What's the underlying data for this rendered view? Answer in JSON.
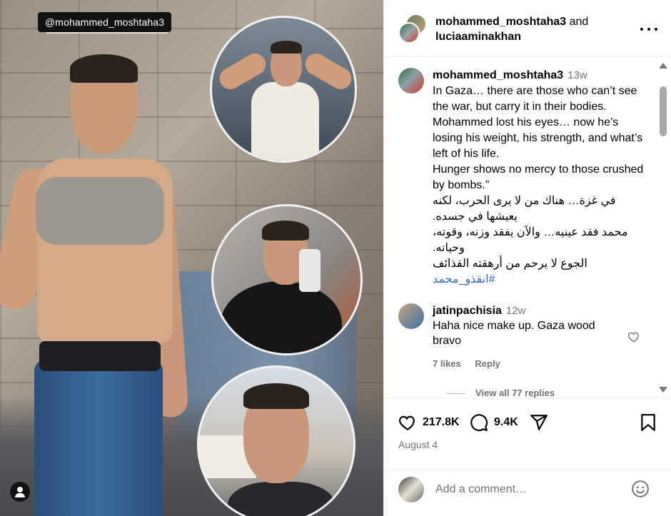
{
  "media": {
    "watermark": "@mohammed_moshtaha3"
  },
  "header": {
    "user1": "mohammed_moshtaha3",
    "conjunction": "and",
    "user2": "luciaaminakhan"
  },
  "caption": {
    "username": "mohammed_moshtaha3",
    "age": "13w",
    "text": "In Gaza… there are those who can’t see the war, but carry it in their bodies.\nMohammed lost his eyes… now he’s losing his weight, his strength, and what’s left of his life.\nHunger shows no mercy to those crushed by bombs.”",
    "arabic": "في غزة… هناك من لا يرى الحرب، لكنه يعيشها في جسده.\nمحمد فقد عينيه… والآن يفقد وزنه، وقوته، وحياته.\nالجوع لا يرحم من أرهقته القذائف",
    "hashtag": "#انقذو_محمد"
  },
  "comment": {
    "username": "jatinpachisia",
    "age": "12w",
    "text": "Haha nice make up. Gaza wood bravo",
    "likes": "7 likes",
    "reply": "Reply",
    "view_replies": "View all 77 replies"
  },
  "actions": {
    "likes": "217.8K",
    "comments": "9.4K",
    "date": "August 4"
  },
  "add_comment": {
    "placeholder": "Add a comment…"
  },
  "icons": {
    "like": "heart-icon",
    "comment": "comment-bubble-icon",
    "share": "paper-plane-icon",
    "save": "bookmark-icon",
    "emoji": "smiley-icon",
    "more": "ellipsis-icon",
    "tagged_users": "person-icon"
  }
}
